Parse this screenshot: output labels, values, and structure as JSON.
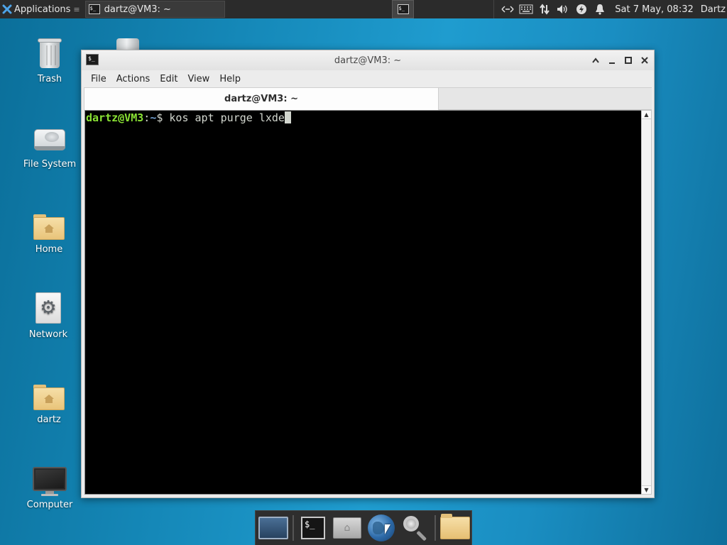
{
  "top_panel": {
    "applications_label": "Applications",
    "applications_sep": "≡",
    "task_title": "dartz@VM3: ~",
    "clock": "Sat  7 May, 08:32",
    "user": "Dartz",
    "tray_icons": [
      "network-icon",
      "keyboard-icon",
      "transfer-icon",
      "volume-icon",
      "power-icon",
      "notifications-icon"
    ]
  },
  "desktop_icons": [
    {
      "name": "Trash",
      "icon": "trash-icon"
    },
    {
      "name": "File System",
      "icon": "harddrive-icon"
    },
    {
      "name": "Home",
      "icon": "home-folder-icon"
    },
    {
      "name": "Network",
      "icon": "network-gear-icon"
    },
    {
      "name": "dartz",
      "icon": "home-folder-icon"
    },
    {
      "name": "Computer",
      "icon": "monitor-icon"
    }
  ],
  "window": {
    "title": "dartz@VM3: ~",
    "menu": [
      "File",
      "Actions",
      "Edit",
      "View",
      "Help"
    ],
    "tab_title": "dartz@VM3: ~"
  },
  "terminal": {
    "user_host": "dartz@VM3",
    "colon": ":",
    "path": "~",
    "prompt_symbol": "$",
    "command": " kos apt purge lxde",
    "colors": {
      "user": "#8ae234",
      "path": "#729fcf",
      "text": "#d3d7cf",
      "background": "#000000"
    }
  },
  "dock": {
    "items": [
      "show-desktop-icon",
      "terminal-icon",
      "home-folder-icon",
      "web-browser-icon",
      "app-finder-icon",
      "file-manager-icon"
    ]
  }
}
